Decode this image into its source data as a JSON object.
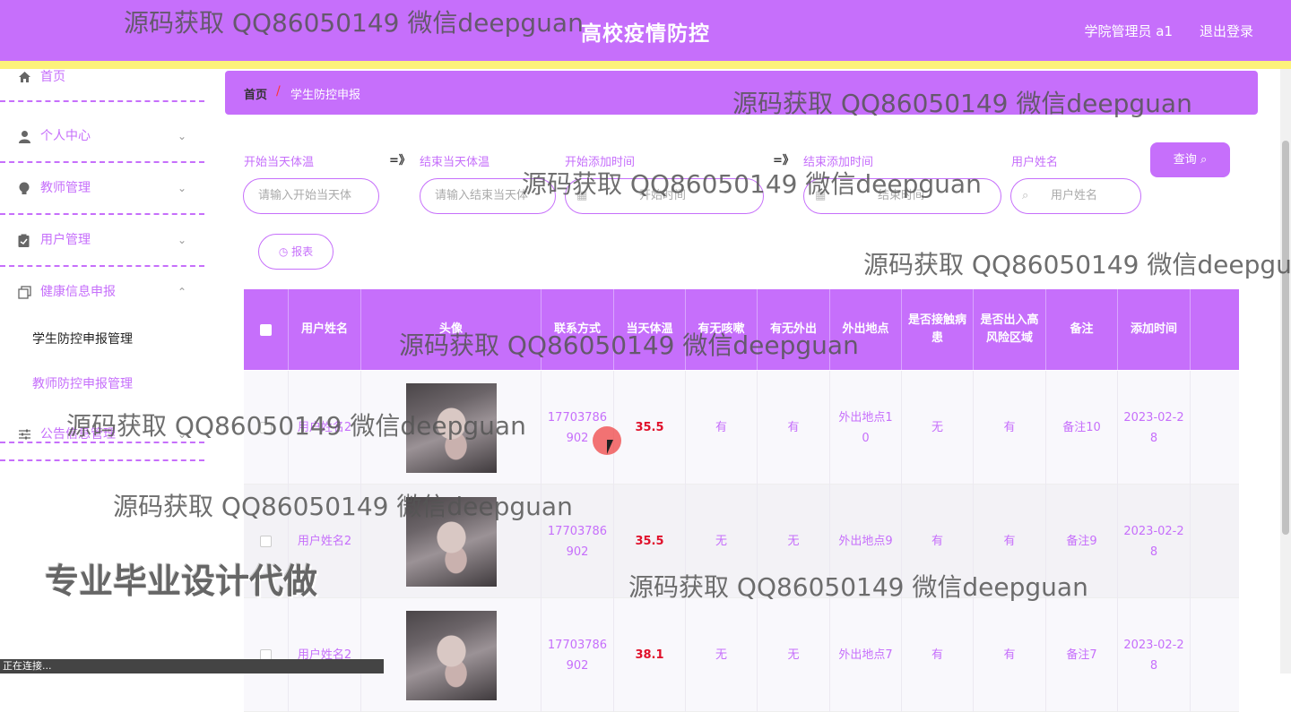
{
  "header": {
    "title": "高校疫情防控",
    "user": "学院管理员 a1",
    "logout": "退出登录"
  },
  "sidebar": {
    "items": [
      {
        "label": "首页",
        "icon": "home-icon"
      },
      {
        "label": "个人中心",
        "icon": "user-icon"
      },
      {
        "label": "教师管理",
        "icon": "bulb-icon"
      },
      {
        "label": "用户管理",
        "icon": "clipboard-icon"
      },
      {
        "label": "健康信息申报",
        "icon": "copy-icon"
      },
      {
        "label": "公告信息管理",
        "icon": "sliders-icon"
      }
    ],
    "subitems": [
      "学生防控申报管理",
      "教师防控申报管理"
    ]
  },
  "breadcrumb": {
    "home": "首页",
    "sep": "/",
    "current": "学生防控申报"
  },
  "filters": {
    "start_temp_label": "开始当天体温",
    "start_temp_placeholder": "请输入开始当天体",
    "arrow": "=》",
    "end_temp_label": "结束当天体温",
    "end_temp_placeholder": "请输入结束当天体",
    "start_time_label": "开始添加时间",
    "start_time_placeholder": "开始时间",
    "end_time_label": "结束添加时间",
    "end_time_placeholder": "结束时间",
    "username_label": "用户姓名",
    "username_placeholder": "用户姓名",
    "query_button": "查询",
    "report_button": "报表"
  },
  "table": {
    "headers": [
      "用户姓名",
      "头像",
      "联系方式",
      "当天体温",
      "有无咳嗽",
      "有无外出",
      "外出地点",
      "是否接触病患",
      "是否出入高风险区域",
      "备注",
      "添加时间"
    ],
    "rows": [
      {
        "name": "用户姓名2",
        "phone": "17703786902",
        "temp": "35.5",
        "cough": "有",
        "out": "有",
        "place": "外出地点10",
        "contact": "无",
        "risk": "有",
        "note": "备注10",
        "time": "2023-02-28"
      },
      {
        "name": "用户姓名2",
        "phone": "17703786902",
        "temp": "35.5",
        "cough": "无",
        "out": "无",
        "place": "外出地点9",
        "contact": "有",
        "risk": "有",
        "note": "备注9",
        "time": "2023-02-28"
      },
      {
        "name": "用户姓名2",
        "phone": "17703786902",
        "temp": "38.1",
        "cough": "无",
        "out": "无",
        "place": "外出地点7",
        "contact": "有",
        "risk": "有",
        "note": "备注7",
        "time": "2023-02-28"
      }
    ]
  },
  "watermarks": {
    "text": "源码获取 QQ86050149 微信deepguan",
    "big": "专业毕业设计代做"
  },
  "status": "正在连接..."
}
